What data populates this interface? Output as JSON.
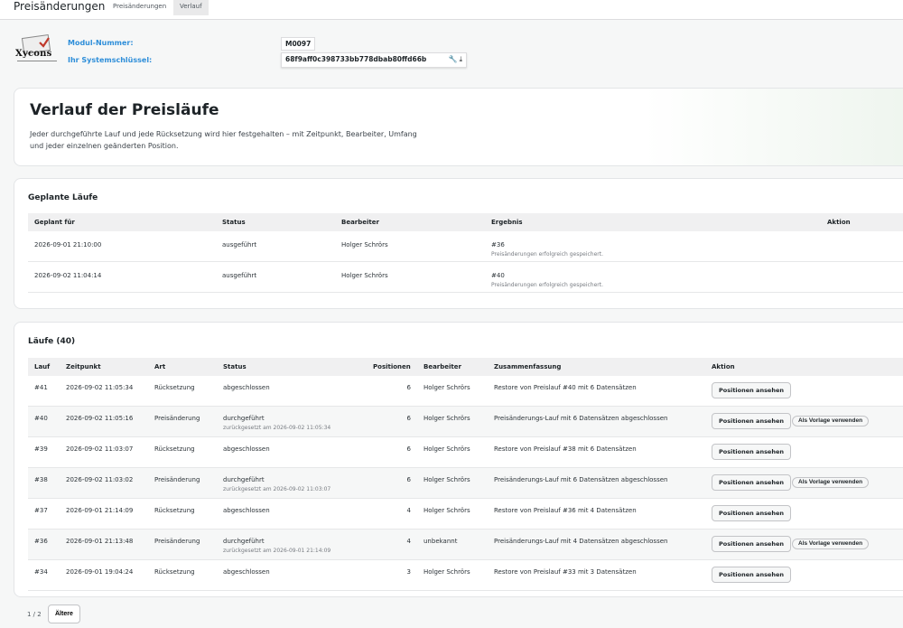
{
  "app": {
    "title": "Preisänderungen"
  },
  "tabs": [
    {
      "label": "Preisänderungen",
      "active": false
    },
    {
      "label": "Verlauf",
      "active": true
    }
  ],
  "module": {
    "logo_text": "Xycons",
    "number_label": "Modul-Nummer:",
    "number_value": "M0097",
    "key_label": "Ihr Systemschlüssel:",
    "key_value": "68f9aff0c398733bb778dbab80ffd66b"
  },
  "hero": {
    "title": "Verlauf der Preisläufe",
    "description": "Jeder durchgeführte Lauf und jede Rücksetzung wird hier festgehalten – mit Zeitpunkt, Bearbeiter, Umfang und jeder einzelnen geänderten Position."
  },
  "planned": {
    "title": "Geplante Läufe",
    "columns": [
      "Geplant für",
      "Status",
      "Bearbeiter",
      "Ergebnis",
      "Aktion"
    ],
    "rows": [
      {
        "date": "2026-09-01 21:10:00",
        "status": "ausgeführt",
        "editor": "Holger Schrörs",
        "result": "#36",
        "result_note": "Preisänderungen erfolgreich gespeichert."
      },
      {
        "date": "2026-09-02 11:04:14",
        "status": "ausgeführt",
        "editor": "Holger Schrörs",
        "result": "#40",
        "result_note": "Preisänderungen erfolgreich gespeichert."
      }
    ]
  },
  "runs": {
    "title": "Läufe (40)",
    "columns": [
      "Lauf",
      "Zeitpunkt",
      "Art",
      "Status",
      "Positionen",
      "Bearbeiter",
      "Zusammenfassung",
      "Aktion"
    ],
    "view_label": "Positionen ansehen",
    "template_label": "Als Vorlage verwenden",
    "rows": [
      {
        "id": "#41",
        "time": "2026-09-02 11:05:34",
        "type": "Rücksetzung",
        "status": "abgeschlossen",
        "status_note": "",
        "positions": "6",
        "editor": "Holger Schrörs",
        "summary": "Restore von Preislauf #40 mit 6 Datensätzen",
        "template": false
      },
      {
        "id": "#40",
        "time": "2026-09-02 11:05:16",
        "type": "Preisänderung",
        "status": "durchgeführt",
        "status_note": "zurückgesetzt am 2026-09-02 11:05:34",
        "positions": "6",
        "editor": "Holger Schrörs",
        "summary": "Preisänderungs-Lauf mit 6 Datensätzen abgeschlossen",
        "template": true
      },
      {
        "id": "#39",
        "time": "2026-09-02 11:03:07",
        "type": "Rücksetzung",
        "status": "abgeschlossen",
        "status_note": "",
        "positions": "6",
        "editor": "Holger Schrörs",
        "summary": "Restore von Preislauf #38 mit 6 Datensätzen",
        "template": false
      },
      {
        "id": "#38",
        "time": "2026-09-02 11:03:02",
        "type": "Preisänderung",
        "status": "durchgeführt",
        "status_note": "zurückgesetzt am 2026-09-02 11:03:07",
        "positions": "6",
        "editor": "Holger Schrörs",
        "summary": "Preisänderungs-Lauf mit 6 Datensätzen abgeschlossen",
        "template": true
      },
      {
        "id": "#37",
        "time": "2026-09-01 21:14:09",
        "type": "Rücksetzung",
        "status": "abgeschlossen",
        "status_note": "",
        "positions": "4",
        "editor": "Holger Schrörs",
        "summary": "Restore von Preislauf #36 mit 4 Datensätzen",
        "template": false
      },
      {
        "id": "#36",
        "time": "2026-09-01 21:13:48",
        "type": "Preisänderung",
        "status": "durchgeführt",
        "status_note": "zurückgesetzt am 2026-09-01 21:14:09",
        "positions": "4",
        "editor": "unbekannt",
        "summary": "Preisänderungs-Lauf mit 4 Datensätzen abgeschlossen",
        "template": true
      },
      {
        "id": "#34",
        "time": "2026-09-01 19:04:24",
        "type": "Rücksetzung",
        "status": "abgeschlossen",
        "status_note": "",
        "positions": "3",
        "editor": "Holger Schrörs",
        "summary": "Restore von Preislauf #33 mit 3 Datensätzen",
        "template": false
      }
    ]
  },
  "pager": {
    "text": "1 / 2",
    "older_label": "Ältere"
  },
  "colors": {
    "accent": "#2e8ed9",
    "header_bg": "#f0f0f1",
    "alt_row": "#f6f7f7"
  }
}
